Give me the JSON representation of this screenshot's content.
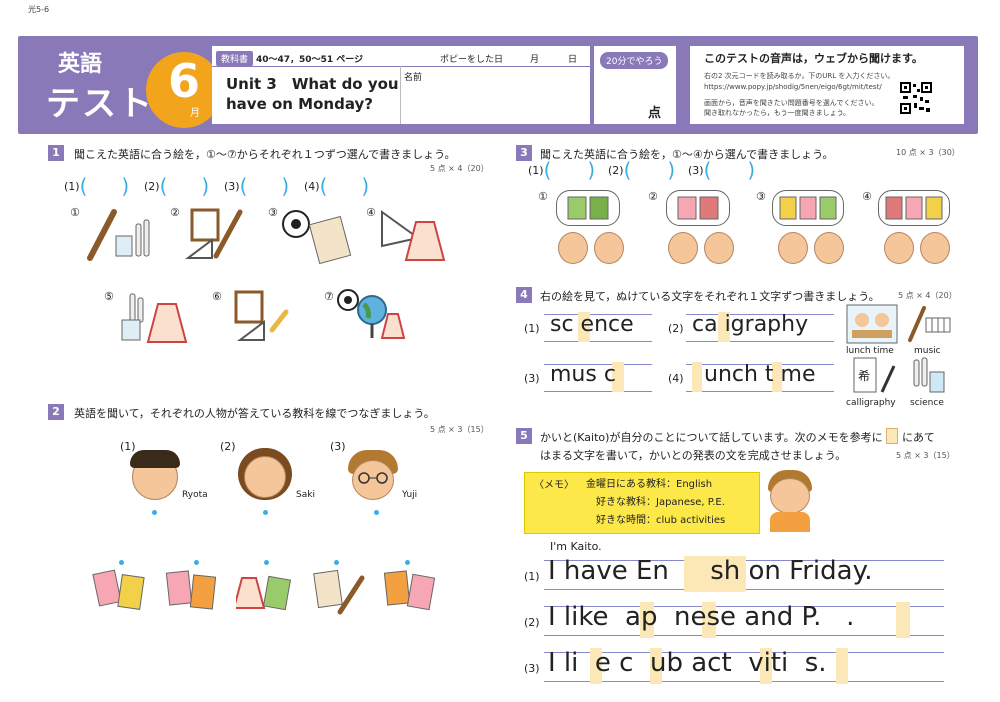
{
  "page_code": "光5-6",
  "header": {
    "subject": "英語",
    "test": "テスト",
    "month_num": "6",
    "month_suffix": "月",
    "textbook_tag": "教科書",
    "textbook_pages": "40〜47，50〜51 ページ",
    "date_label": "ポピーをした日",
    "date_month": "月",
    "date_day": "日",
    "unit_title": "Unit 3　What do you have on Monday?",
    "name_label": "名前",
    "time_tag": "20分でやろう",
    "points_label": "点",
    "audio_title": "このテストの音声は，ウェブから聞けます。",
    "audio_line1": "右の2 次元コードを読み取るか，下のURL を入力ください。",
    "audio_url": "https://www.popy.jp/shodig/5nen/eigo/6gt/mit/test/",
    "audio_line2": "画面から，音声を聞きたい問題番号を選んでください。",
    "audio_line3": "聞き取れなかったら，もう一度聞きましょう。"
  },
  "q1": {
    "num": "1",
    "text": "聞こえた英語に合う絵を，①〜⑦からそれぞれ１つずつ選んで書きましょう。",
    "score": "5 点 × 4（20）",
    "blanks": [
      "(1)",
      "(2)",
      "(3)",
      "(4)"
    ],
    "pics": [
      "①",
      "②",
      "③",
      "④",
      "⑤",
      "⑥",
      "⑦"
    ]
  },
  "q2": {
    "num": "2",
    "text": "英語を聞いて，それぞれの人物が答えている教科を線でつなぎましょう。",
    "score": "5 点 × 3（15）",
    "people": [
      {
        "n": "(1)",
        "name": "Ryota"
      },
      {
        "n": "(2)",
        "name": "Saki"
      },
      {
        "n": "(3)",
        "name": "Yuji"
      }
    ]
  },
  "q3": {
    "num": "3",
    "text": "聞こえた英語に合う絵を，①〜④から選んで書きましょう。",
    "score": "10 点 × 3（30）",
    "blanks": [
      "(1)",
      "(2)",
      "(3)"
    ],
    "pics": [
      "①",
      "②",
      "③",
      "④"
    ]
  },
  "q4": {
    "num": "4",
    "text": "右の絵を見て，ぬけている文字をそれぞれ１文字ずつ書きましょう。",
    "score": "5 点 × 4（20）",
    "items": [
      {
        "n": "(1)",
        "w": "sc ence"
      },
      {
        "n": "(2)",
        "w": "ca igraphy"
      },
      {
        "n": "(3)",
        "w": "mus c"
      },
      {
        "n": "(4)",
        "w": "unch t me"
      }
    ],
    "labels": [
      "lunch time",
      "music",
      "calligraphy",
      "science"
    ]
  },
  "q5": {
    "num": "5",
    "text1": "かいと(Kaito)が自分のことについて話しています。次のメモを参考に",
    "text2": "にあて",
    "text3": "はまる文字を書いて，かいとの発表の文を完成させましょう。",
    "score": "5 点 × 3（15）",
    "memo_title": "〈メモ〉",
    "memo": [
      {
        "k": "金曜日にある教科：",
        "v": "English"
      },
      {
        "k": "好きな教科：",
        "v": "Japanese, P.E."
      },
      {
        "k": "好きな時間：",
        "v": "club activities"
      }
    ],
    "intro": "I'm Kaito.",
    "lines": [
      {
        "n": "(1)",
        "t": "I have En     sh on Friday."
      },
      {
        "n": "(2)",
        "t": "I like  ap  nese and P.   ."
      },
      {
        "n": "(3)",
        "t": "I li  e c  ub act  viti  s."
      }
    ]
  }
}
